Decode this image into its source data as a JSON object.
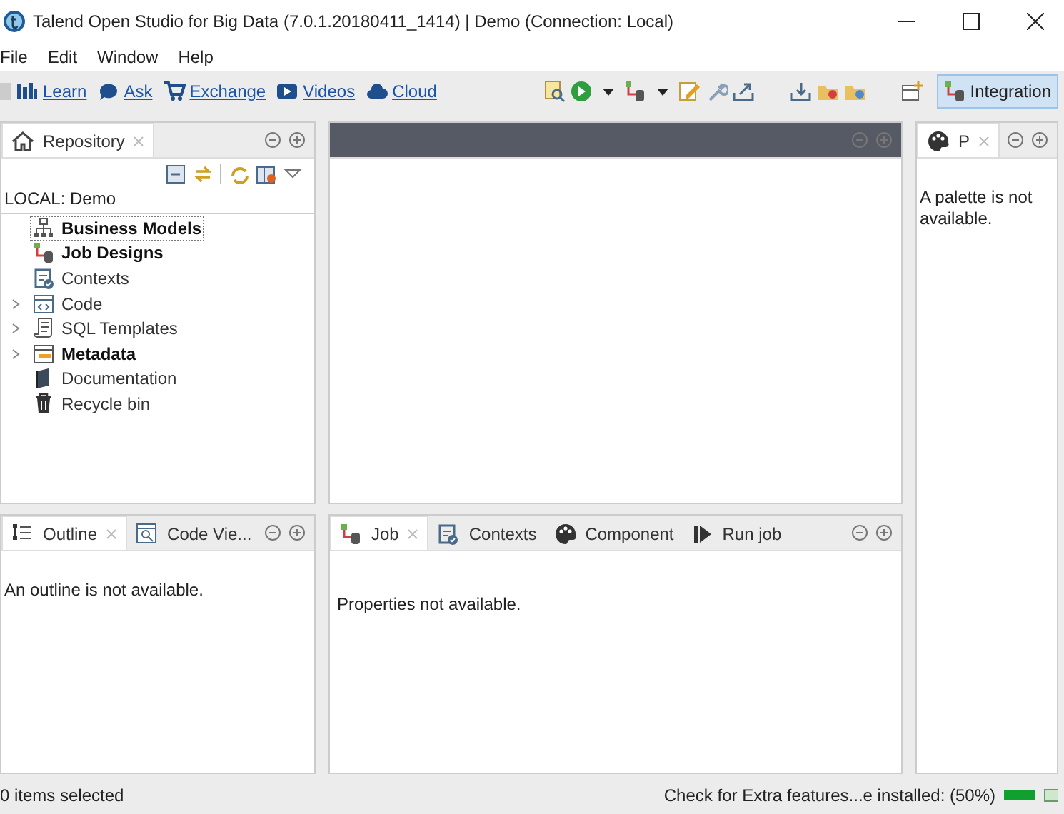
{
  "window": {
    "title": "Talend Open Studio for Big Data (7.0.1.20180411_1414) | Demo (Connection: Local)"
  },
  "menu": [
    "File",
    "Edit",
    "Window",
    "Help"
  ],
  "links": [
    {
      "label": "Learn",
      "kind": "learn"
    },
    {
      "label": "Ask",
      "kind": "ask"
    },
    {
      "label": "Exchange",
      "kind": "exchange"
    },
    {
      "label": "Videos",
      "kind": "videos"
    },
    {
      "label": "Cloud",
      "kind": "cloud"
    }
  ],
  "perspective": {
    "label": "Integration",
    "selected": true
  },
  "repository": {
    "tab": {
      "label": "Repository",
      "selected": true
    },
    "project": "LOCAL: Demo",
    "items": [
      {
        "label": "Business Models",
        "bold": true,
        "expandable": false,
        "selected": true,
        "kind": "models"
      },
      {
        "label": "Job Designs",
        "bold": true,
        "expandable": false,
        "selected": false,
        "kind": "jobs"
      },
      {
        "label": "Contexts",
        "bold": false,
        "expandable": false,
        "selected": false,
        "kind": "contexts"
      },
      {
        "label": "Code",
        "bold": false,
        "expandable": true,
        "selected": false,
        "kind": "code"
      },
      {
        "label": "SQL Templates",
        "bold": false,
        "expandable": true,
        "selected": false,
        "kind": "sql"
      },
      {
        "label": "Metadata",
        "bold": true,
        "expandable": true,
        "selected": false,
        "kind": "metadata"
      },
      {
        "label": "Documentation",
        "bold": false,
        "expandable": false,
        "selected": false,
        "kind": "docs"
      },
      {
        "label": "Recycle bin",
        "bold": false,
        "expandable": false,
        "selected": false,
        "kind": "bin"
      }
    ]
  },
  "palette": {
    "tab": {
      "label": "P",
      "selected": true
    },
    "message": "A palette is not available."
  },
  "outline": {
    "tabs": [
      {
        "label": "Outline",
        "selected": true,
        "kind": "outline"
      },
      {
        "label": "Code Vie...",
        "selected": false,
        "kind": "codeview"
      }
    ],
    "message": "An outline is not available."
  },
  "job": {
    "tabs": [
      {
        "label": "Job",
        "selected": true,
        "kind": "job"
      },
      {
        "label": "Contexts",
        "selected": false,
        "kind": "contexts"
      },
      {
        "label": "Component",
        "selected": false,
        "kind": "component"
      },
      {
        "label": "Run job",
        "selected": false,
        "kind": "run"
      }
    ],
    "message": "Properties not available."
  },
  "status_bar": {
    "left": "0 items selected",
    "task": "Check for Extra features...e installed: (50%)",
    "level": 1
  }
}
